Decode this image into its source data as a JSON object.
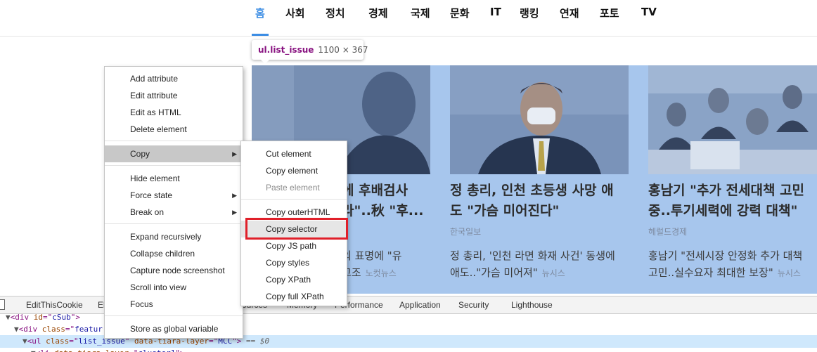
{
  "nav": {
    "items": [
      "홈",
      "사회",
      "정치",
      "경제",
      "국제",
      "문화",
      "IT",
      "랭킹",
      "연재",
      "포토",
      "TV"
    ],
    "active_index": 0,
    "accent": "#3b8de4"
  },
  "tooltip": {
    "selector": "ul.list_issue",
    "size": "1100 × 367"
  },
  "cards": [
    {
      "title_line1": "에 후배검사",
      "title_line2": "라\"..秋 \"후...",
      "desc_line1": "의 표명에 \"유",
      "desc_line2": "고조",
      "desc_source": "노컷뉴스"
    },
    {
      "title_line1": "정 총리, 인천 초등생 사망 애",
      "title_line2": "도 \"가슴 미어진다\"",
      "source": "한국일보",
      "desc_line1": "정 총리, '인천 라면 화재 사건' 동생에",
      "desc_line2": "애도..\"가슴 미어져\"",
      "desc_source": "뉴시스"
    },
    {
      "title_line1": "홍남기 \"추가 전세대책 고민",
      "title_line2": "중..투기세력에 강력 대책\"",
      "source": "헤럴드경제",
      "desc_line1": "홍남기 \"전세시장 안정화 추가 대책",
      "desc_line2": "고민..실수요자 최대한 보장\"",
      "desc_source": "뉴시스"
    }
  ],
  "devtools": {
    "tabs": [
      "EditThisCookie",
      "El",
      "Sources",
      "Memory",
      "Performance",
      "Application",
      "Security",
      "Lighthouse"
    ],
    "dom": {
      "line1": {
        "tag": "div",
        "attr": "id",
        "value": "cSub"
      },
      "line2": {
        "tag": "div",
        "attr": "class",
        "value": "featur"
      },
      "line3": {
        "tag": "ul",
        "attr1": "class",
        "value1": "list_issue",
        "attr2": "data-tiara-layer",
        "value2": "MCC",
        "suffix": "== $0"
      },
      "line4": {
        "tag": "li",
        "attr": "data-tiara-layer",
        "value": "cluster1"
      }
    }
  },
  "context_menu": {
    "items": [
      {
        "label": "Add attribute"
      },
      {
        "label": "Edit attribute"
      },
      {
        "label": "Edit as HTML"
      },
      {
        "label": "Delete element"
      },
      {
        "label": "Copy",
        "submenu": true
      },
      {
        "label": "Hide element"
      },
      {
        "label": "Force state",
        "submenu": true
      },
      {
        "label": "Break on",
        "submenu": true
      },
      {
        "label": "Expand recursively"
      },
      {
        "label": "Collapse children"
      },
      {
        "label": "Capture node screenshot"
      },
      {
        "label": "Scroll into view"
      },
      {
        "label": "Focus"
      },
      {
        "label": "Store as global variable"
      }
    ]
  },
  "copy_submenu": {
    "items": [
      {
        "label": "Cut element"
      },
      {
        "label": "Copy element"
      },
      {
        "label": "Paste element",
        "disabled": true
      },
      {
        "label": "Copy outerHTML"
      },
      {
        "label": "Copy selector"
      },
      {
        "label": "Copy JS path"
      },
      {
        "label": "Copy styles"
      },
      {
        "label": "Copy XPath"
      },
      {
        "label": "Copy full XPath"
      }
    ]
  }
}
